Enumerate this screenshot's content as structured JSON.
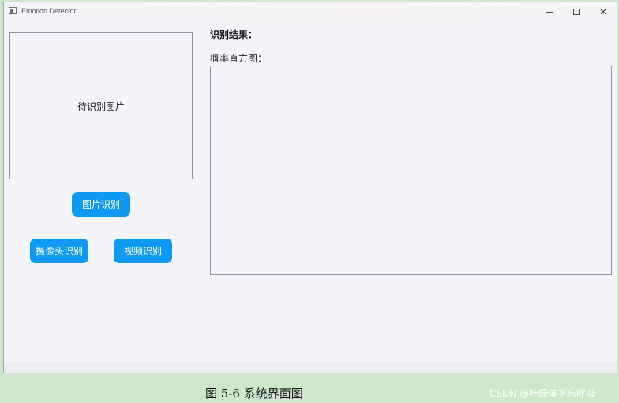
{
  "window": {
    "title": "Emotion Detector",
    "controls": {
      "minimize": "",
      "maximize": "",
      "close": "✕"
    }
  },
  "left_panel": {
    "image_placeholder": "待识别图片",
    "buttons": {
      "image_recognition": "图片识别",
      "camera_recognition": "摄像头识别",
      "video_recognition": "视频识别"
    }
  },
  "right_panel": {
    "result_label": "识别结果：",
    "histogram_label": "概率直方图："
  },
  "caption": "图 5-6  系统界面图",
  "watermark": "CSDN @叶绿体不忘呼吸",
  "colors": {
    "button_blue": "#0e9af2",
    "window_bg": "#f4f5fa",
    "page_bg": "#cfe6cc"
  }
}
